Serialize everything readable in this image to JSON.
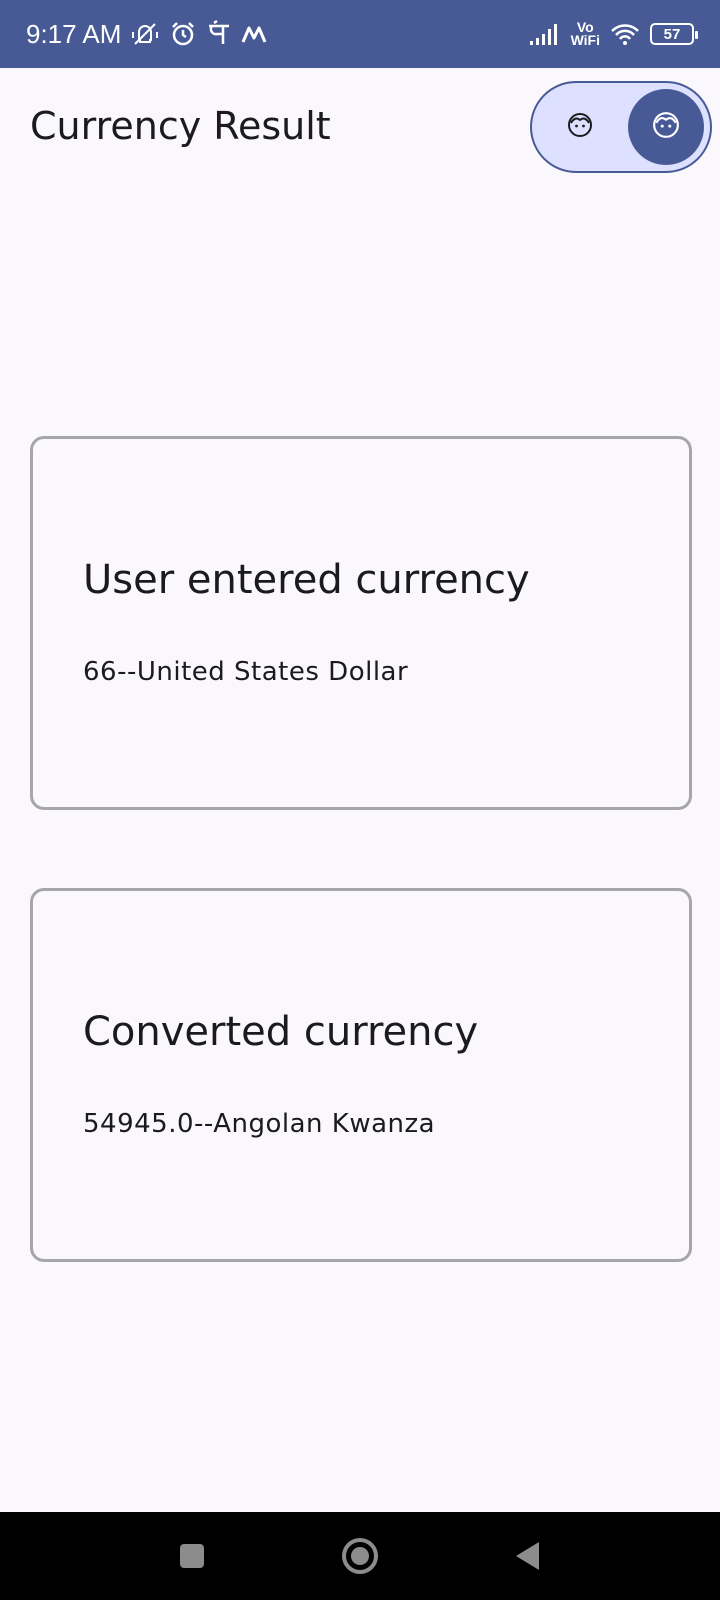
{
  "status_bar": {
    "time": "9:17 AM",
    "icons_left": [
      "vibrate-off-icon",
      "alarm-icon",
      "pe-app-icon",
      "m-app-icon"
    ],
    "vowifi_top": "Vo",
    "vowifi_bottom": "WiFi",
    "battery": "57",
    "colors": {
      "background": "#485a96",
      "foreground": "#ffffff"
    }
  },
  "header": {
    "title": "Currency Result",
    "theme_toggle": {
      "left_icon": "face-icon",
      "right_icon": "face-icon",
      "selected": "right"
    }
  },
  "cards": [
    {
      "heading": "User entered currency",
      "value": "66--United States Dollar"
    },
    {
      "heading": "Converted currency",
      "value": "54945.0--Angolan Kwanza"
    }
  ],
  "nav_bar": {
    "buttons": [
      "recents-icon",
      "home-icon",
      "back-icon"
    ]
  },
  "colors": {
    "accent": "#485a96",
    "toggle_bg": "#dde1ff",
    "page_bg": "#fbf8fd",
    "card_border": "#a6a6aa"
  }
}
